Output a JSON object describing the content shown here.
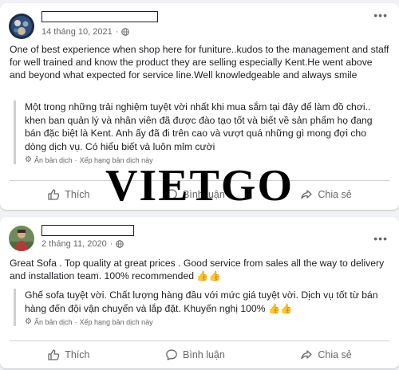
{
  "colors": {
    "background": "#f0f2f5",
    "card": "#ffffff",
    "secondary_text": "#65676b",
    "watermark": "#000000"
  },
  "watermark": "VIETGO",
  "posts": [
    {
      "date": "14 tháng 10, 2021",
      "privacy_icon": "globe-icon",
      "review": "One of best experience when shop here for funiture..kudos to the management and staff for well trained and know the product they are selling especially Kent.He went above and beyond what expected for service line.Well knowledgeable and always smile",
      "translation": "Một trong những trải nghiệm tuyệt vời nhất khi mua sắm tại đây để làm đồ chơi.. khen ban quản lý và nhân viên đã được đào tạo tốt và biết về sản phẩm họ đang bán đặc biệt là Kent. Anh ấy đã đi trên cao và vượt quá những gì mong đợi cho dòng dịch vụ. Có hiểu biết và luôn mỉm cười",
      "hide_translation": "Ẩn bản dịch",
      "separator": "·",
      "rate_translation": "Xếp hạng bản dịch này"
    },
    {
      "date": "2 tháng 11, 2020",
      "privacy_icon": "globe-icon",
      "review": "Great Sofa . Top quality at great prices . Good service from sales all the way to delivery and installation team. 100% recommended",
      "translation": "Ghế sofa tuyệt vời. Chất lượng hàng đầu với mức giá tuyệt vời. Dịch vụ tốt từ bán hàng đến đội vận chuyển và lắp đặt. Khuyến nghị 100%",
      "hide_translation": "Ẩn bản dịch",
      "separator": "·",
      "rate_translation": "Xếp hạng bản dịch này"
    }
  ],
  "emoji": "👍👍",
  "actions": {
    "like": "Thích",
    "comment": "Bình luận",
    "share": "Chia sẻ"
  },
  "more_label": "•••"
}
